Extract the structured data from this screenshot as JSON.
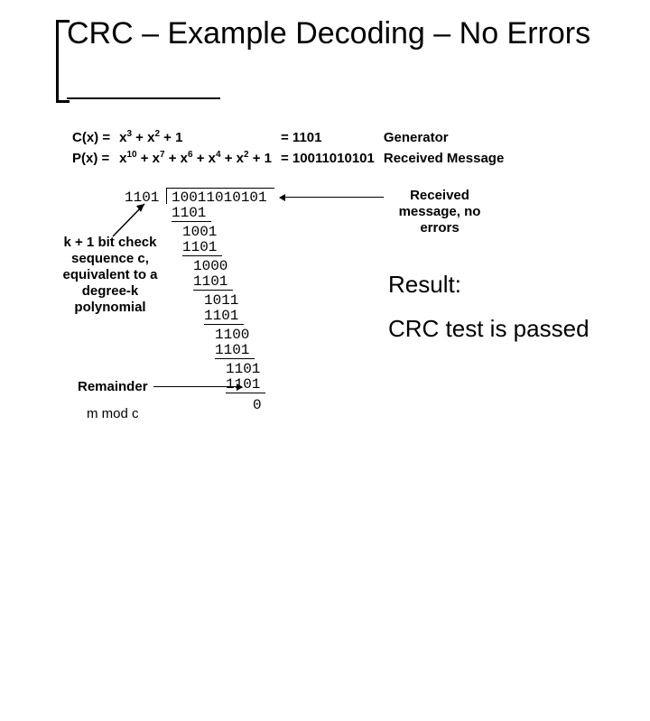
{
  "title_line": "CRC – Example Decoding – No Errors",
  "defs": {
    "r1": {
      "lhs": "C(x) =",
      "poly": "x3 + x2 + 1",
      "bin": "= 1101",
      "role": "Generator"
    },
    "r2": {
      "lhs": "P(x) =",
      "poly": "x10 + x7 + x6 + x4 + x2 + 1",
      "bin": "= 10011010101",
      "role": "Received Message"
    }
  },
  "division": {
    "divisor": "1101",
    "dividend": "10011010101",
    "steps": [
      {
        "indent": 0,
        "top": "10011010101",
        "sub": "1101"
      },
      {
        "indent": 1,
        "top": "1001",
        "sub": "1101"
      },
      {
        "indent": 2,
        "top": "1000",
        "sub": "1101"
      },
      {
        "indent": 3,
        "top": "1011",
        "sub": "1101"
      },
      {
        "indent": 4,
        "top": "1100",
        "sub": "1101"
      },
      {
        "indent": 5,
        "top": "1101",
        "sub": "1101"
      }
    ],
    "remainder": "0"
  },
  "labels": {
    "check_seq": [
      "k + 1 bit check",
      "sequence c,",
      "equivalent to a",
      "degree-k",
      "polynomial"
    ],
    "received": [
      "Received",
      "message, no",
      "errors"
    ],
    "remainder_label": "Remainder",
    "mmodc": "m mod c"
  },
  "result": {
    "heading": "Result:",
    "text": "CRC test is passed"
  },
  "chart_data": {
    "type": "table",
    "title": "CRC polynomial long division (decoding, no errors)",
    "generator_bits": "1101",
    "received_bits": "10011010101",
    "steps_partial_remainders": [
      "1001",
      "1000",
      "1011",
      "1100",
      "1101"
    ],
    "final_remainder": "0",
    "conclusion": "CRC test is passed"
  }
}
